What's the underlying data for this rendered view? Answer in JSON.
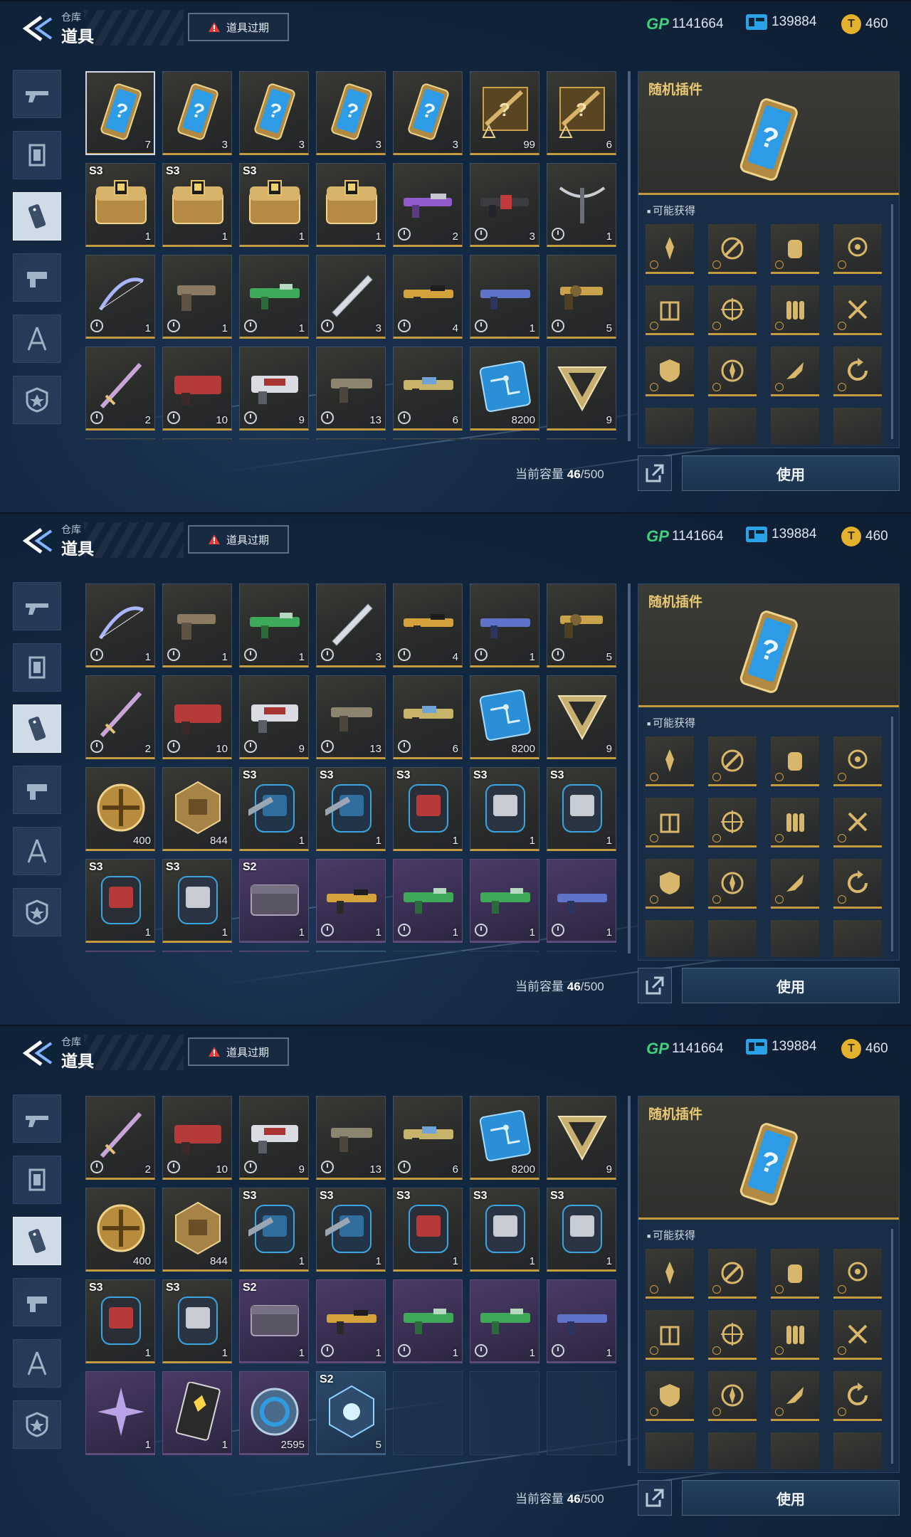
{
  "header": {
    "title_small": "仓库",
    "title_big": "道具",
    "expire_button": "道具过期"
  },
  "currencies": [
    {
      "name": "GP",
      "icon": "gp-icon",
      "icon_text": "GP",
      "value": "1141664"
    },
    {
      "name": "ticket",
      "icon": "ticket-icon",
      "value": "139884"
    },
    {
      "name": "coin",
      "icon": "coin-icon",
      "value": "460"
    }
  ],
  "sidebar_tabs": [
    {
      "icon": "gun-icon"
    },
    {
      "icon": "card-icon"
    },
    {
      "icon": "tag-icon",
      "active": true
    },
    {
      "icon": "weapon-part-icon"
    },
    {
      "icon": "compass-icon"
    },
    {
      "icon": "star-shield-icon"
    }
  ],
  "inventory": {
    "rows": [
      [
        {
          "art": "plugin-card",
          "count": "7",
          "rarity": "gold",
          "selected": true
        },
        {
          "art": "plugin-card",
          "count": "3",
          "rarity": "gold"
        },
        {
          "art": "plugin-card",
          "count": "3",
          "rarity": "gold"
        },
        {
          "art": "plugin-card",
          "count": "3",
          "rarity": "gold"
        },
        {
          "art": "plugin-card",
          "count": "3",
          "rarity": "gold"
        },
        {
          "art": "mystery-weapon-box",
          "count": "99",
          "rarity": "gold"
        },
        {
          "art": "mystery-weapon-box",
          "count": "6",
          "rarity": "gold"
        }
      ],
      [
        {
          "art": "gold-chest",
          "tag": "S3",
          "count": "1",
          "rarity": "gold"
        },
        {
          "art": "gold-chest",
          "tag": "S3",
          "count": "1",
          "rarity": "gold"
        },
        {
          "art": "gold-chest",
          "tag": "S3",
          "count": "1",
          "rarity": "gold"
        },
        {
          "art": "gold-chest",
          "count": "1",
          "rarity": "gold"
        },
        {
          "art": "rifle-purple",
          "count": "2",
          "rarity": "gold",
          "timed": true
        },
        {
          "art": "rifle-red",
          "count": "3",
          "rarity": "gold",
          "timed": true
        },
        {
          "art": "crossbow",
          "count": "1",
          "rarity": "gold",
          "timed": true
        }
      ],
      [
        {
          "art": "bow",
          "count": "1",
          "rarity": "gold",
          "timed": true
        },
        {
          "art": "pistol",
          "count": "1",
          "rarity": "gold",
          "timed": true
        },
        {
          "art": "rifle-green",
          "count": "1",
          "rarity": "gold",
          "timed": true
        },
        {
          "art": "blade",
          "count": "3",
          "rarity": "gold",
          "timed": true
        },
        {
          "art": "rifle-gold",
          "count": "4",
          "rarity": "gold",
          "timed": true
        },
        {
          "art": "rifle-blue",
          "count": "1",
          "rarity": "gold",
          "timed": true
        },
        {
          "art": "revolver",
          "count": "5",
          "rarity": "gold",
          "timed": true
        }
      ],
      [
        {
          "art": "sword",
          "count": "2",
          "rarity": "gold",
          "timed": true
        },
        {
          "art": "heavy-red",
          "count": "10",
          "rarity": "gold",
          "timed": true
        },
        {
          "art": "heavy-white",
          "count": "9",
          "rarity": "gold",
          "timed": true
        },
        {
          "art": "smg",
          "count": "13",
          "rarity": "gold",
          "timed": true
        },
        {
          "art": "rifle-mixed",
          "count": "6",
          "rarity": "gold",
          "timed": true
        },
        {
          "art": "chip",
          "count": "8200",
          "rarity": "gold"
        },
        {
          "art": "triangle-emblem",
          "count": "9",
          "rarity": "gold"
        }
      ],
      [
        {
          "art": "gold-medal",
          "count": "400",
          "rarity": "gold"
        },
        {
          "art": "hex-crate",
          "count": "844",
          "rarity": "gold"
        },
        {
          "art": "backpack-blue",
          "tag": "S3",
          "count": "1",
          "rarity": "gold"
        },
        {
          "art": "backpack-blue",
          "tag": "S3",
          "count": "1",
          "rarity": "gold"
        },
        {
          "art": "backpack-red",
          "tag": "S3",
          "count": "1",
          "rarity": "gold"
        },
        {
          "art": "backpack-white",
          "tag": "S3",
          "count": "1",
          "rarity": "gold"
        },
        {
          "art": "backpack-white",
          "tag": "S3",
          "count": "1",
          "rarity": "gold"
        }
      ],
      [
        {
          "art": "backpack-red",
          "tag": "S3",
          "count": "1",
          "rarity": "gold"
        },
        {
          "art": "backpack-white",
          "tag": "S3",
          "count": "1",
          "rarity": "gold"
        },
        {
          "art": "case",
          "tag": "S2",
          "count": "1",
          "rarity": "purple"
        },
        {
          "art": "rifle-gold",
          "count": "1",
          "rarity": "purple",
          "timed": true
        },
        {
          "art": "rifle-green",
          "count": "1",
          "rarity": "purple",
          "timed": true
        },
        {
          "art": "rifle-green",
          "count": "1",
          "rarity": "purple",
          "timed": true
        },
        {
          "art": "rifle-blue",
          "count": "1",
          "rarity": "purple",
          "timed": true
        }
      ],
      [
        {
          "art": "shuriken",
          "count": "1",
          "rarity": "purple"
        },
        {
          "art": "card-pack",
          "count": "1",
          "rarity": "purple"
        },
        {
          "art": "ring-token",
          "count": "2595",
          "rarity": "purple"
        },
        {
          "art": "crystal-cube",
          "tag": "S2",
          "count": "5",
          "rarity": "blue"
        },
        {
          "rarity": "empty"
        },
        {
          "rarity": "empty"
        },
        {
          "rarity": "empty"
        }
      ]
    ]
  },
  "detail": {
    "title": "随机插件",
    "possible_label": "可能获得",
    "plugins": [
      "sword-icon",
      "wrench-icon",
      "glove-icon",
      "target-icon",
      "building-icon",
      "crosshair-icon",
      "bullets-icon",
      "tools-icon",
      "shield-icon",
      "compass-icon",
      "rocket-icon",
      "refresh-icon",
      "blank-icon",
      "blank-icon",
      "blank-icon",
      "blank-icon"
    ]
  },
  "capacity": {
    "label": "当前容量",
    "current": "46",
    "max": "/500"
  },
  "use_button": "使用",
  "colors": {
    "gold_rarity": "#c49a3f",
    "purple_rarity": "#9a66d0",
    "blue_rarity": "#3c8fd0",
    "detail_title": "#e8c772",
    "gp": "#3cd37a",
    "ticket": "#2aa3e6",
    "coin": "#e3b22c",
    "warning": "#e53935"
  }
}
